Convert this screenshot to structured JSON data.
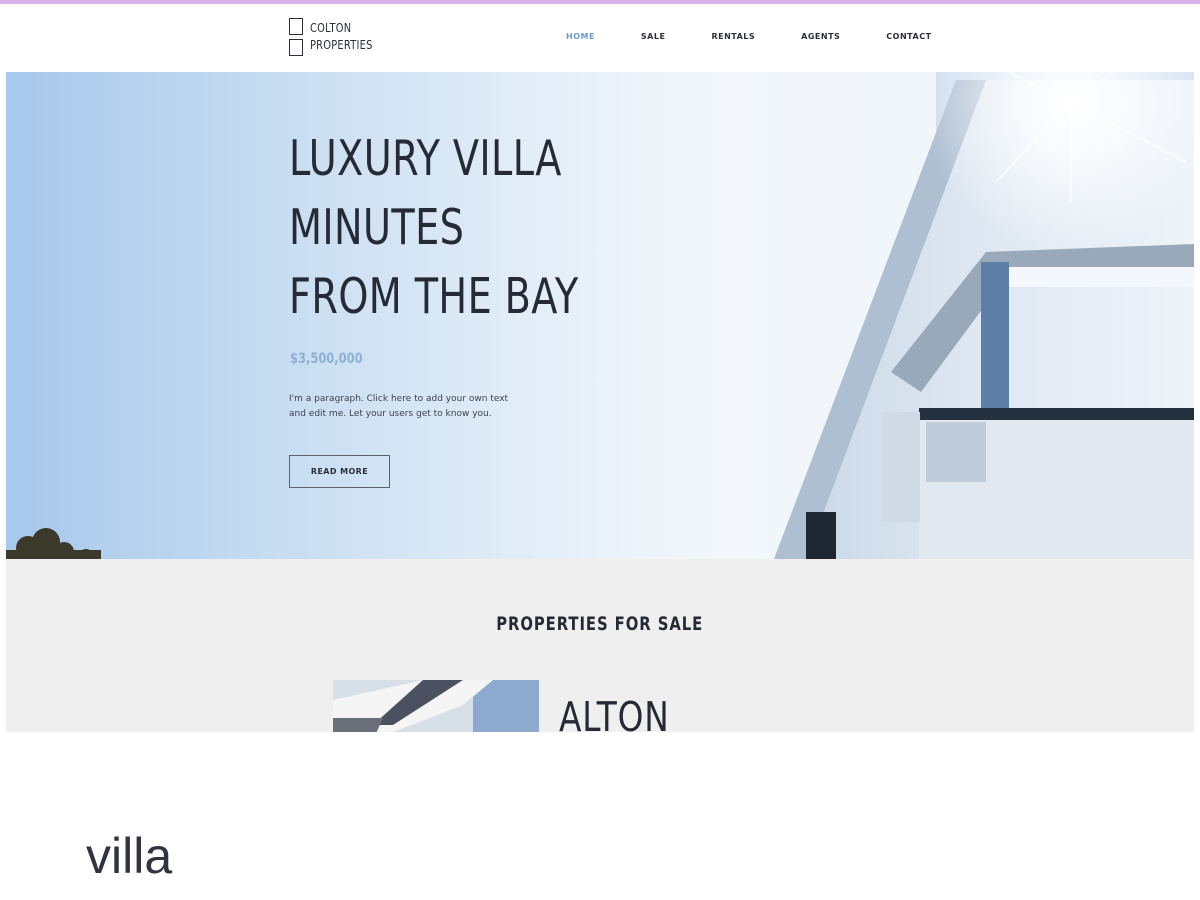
{
  "logo": {
    "line1": "COLTON",
    "line2": "PROPERTIES"
  },
  "nav": {
    "items": [
      {
        "label": "HOME",
        "active": true
      },
      {
        "label": "SALE",
        "active": false
      },
      {
        "label": "RENTALS",
        "active": false
      },
      {
        "label": "AGENTS",
        "active": false
      },
      {
        "label": "CONTACT",
        "active": false
      }
    ]
  },
  "hero": {
    "title_line1": "LUXURY VILLA",
    "title_line2": "MINUTES",
    "title_line3": "FROM THE BAY",
    "price": "$3,500,000",
    "paragraph_line1": "I'm a paragraph. Click here to add your own text",
    "paragraph_line2": "and edit me. Let your users get to know you.",
    "button_label": "READ MORE"
  },
  "properties": {
    "section_title": "PROPERTIES FOR SALE",
    "first_card_title": "ALTON"
  },
  "caption": "villa",
  "colors": {
    "accent": "#6e9bcf",
    "text_dark": "#262a36",
    "section_bg": "#efefef",
    "top_strip": "#d9b3e6"
  }
}
